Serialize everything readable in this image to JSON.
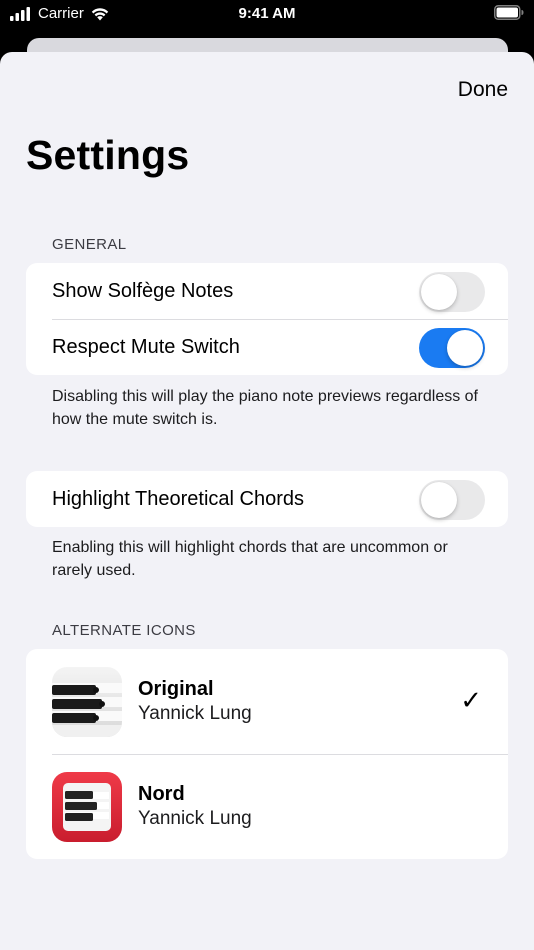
{
  "status_bar": {
    "carrier": "Carrier",
    "time": "9:41 AM"
  },
  "nav": {
    "done_label": "Done",
    "title": "Settings"
  },
  "general": {
    "header": "GENERAL",
    "rows": [
      {
        "label": "Show Solfège Notes",
        "on": false
      },
      {
        "label": "Respect Mute Switch",
        "on": true
      }
    ],
    "footer": "Disabling this will play the piano note previews regardless of how the mute switch is."
  },
  "theory": {
    "rows": [
      {
        "label": "Highlight Theoretical Chords",
        "on": false
      }
    ],
    "footer": "Enabling this will highlight chords that are uncommon or rarely used."
  },
  "alternate_icons": {
    "header": "ALTERNATE ICONS",
    "items": [
      {
        "name": "Original",
        "author": "Yannick Lung",
        "selected": true,
        "icon": "piano-keys-icon"
      },
      {
        "name": "Nord",
        "author": "Yannick Lung",
        "selected": false,
        "icon": "piano-keys-red-icon"
      }
    ],
    "check_glyph": "✓"
  },
  "colors": {
    "accent_toggle_on": "#1a7bf2",
    "toggle_off": "#e9e9ea",
    "sheet_background": "#f2f2f7",
    "nord_red": "#e0303f"
  }
}
